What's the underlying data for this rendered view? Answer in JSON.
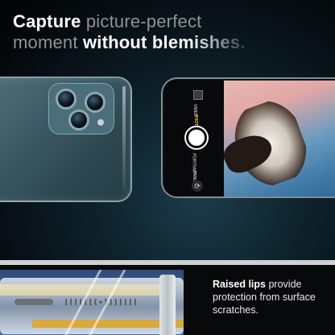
{
  "headline": {
    "line1_bold": "Capture",
    "line1_dim": "picture-perfect",
    "line2_dim": "moment",
    "line2_bold": "without",
    "line2_faded": "blemishes."
  },
  "camera_ui": {
    "modes": [
      "VIDEO",
      "PHOTO",
      "PORTRAIT",
      "PANO"
    ],
    "active_mode": "PHOTO",
    "flip_symbol": "⟳"
  },
  "caption": {
    "bold": "Raised lips",
    "rest": " provide protection from surface scratches."
  },
  "colors": {
    "background": "#000000",
    "case_tint": "#3a5862",
    "accent_mode": "#f6c744"
  },
  "icons": [
    "shutter-button-icon",
    "camera-flip-icon",
    "thumbnail-icon"
  ]
}
